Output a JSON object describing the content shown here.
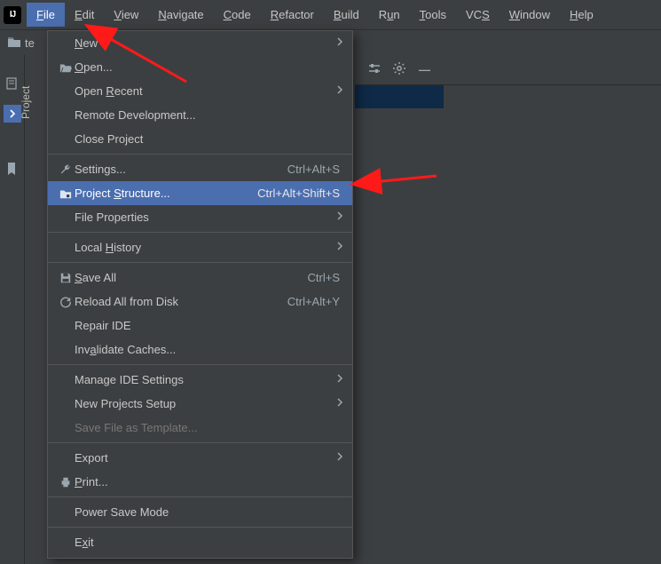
{
  "menubar": {
    "items": [
      {
        "label": "File",
        "mn": "F",
        "active": true
      },
      {
        "label": "Edit",
        "mn": "E",
        "active": false
      },
      {
        "label": "View",
        "mn": "V",
        "active": false
      },
      {
        "label": "Navigate",
        "mn": "N",
        "active": false
      },
      {
        "label": "Code",
        "mn": "C",
        "active": false
      },
      {
        "label": "Refactor",
        "mn": "R",
        "active": false
      },
      {
        "label": "Build",
        "mn": "B",
        "active": false
      },
      {
        "label": "Run",
        "mn": "u",
        "active": false
      },
      {
        "label": "Tools",
        "mn": "T",
        "active": false
      },
      {
        "label": "VCS",
        "mn": "S",
        "active": false
      },
      {
        "label": "Window",
        "mn": "W",
        "active": false
      },
      {
        "label": "Help",
        "mn": "H",
        "active": false
      }
    ]
  },
  "crumb": {
    "label": "te"
  },
  "side": {
    "label": "Project"
  },
  "dropdown": [
    {
      "type": "item",
      "label": "New",
      "mn": "N",
      "icon": "",
      "submenu": true
    },
    {
      "type": "item",
      "label": "Open...",
      "mn": "O",
      "icon": "folder-open"
    },
    {
      "type": "item",
      "label": "Open Recent",
      "mn": "R",
      "submenu": true
    },
    {
      "type": "item",
      "label": "Remote Development..."
    },
    {
      "type": "item",
      "label": "Close Project",
      "mn": "J"
    },
    {
      "type": "sep"
    },
    {
      "type": "item",
      "label": "Settings...",
      "mn": "T",
      "icon": "wrench",
      "shortcut": "Ctrl+Alt+S"
    },
    {
      "type": "item",
      "label": "Project Structure...",
      "mn": "S",
      "icon": "folder-gear",
      "shortcut": "Ctrl+Alt+Shift+S",
      "highlight": true
    },
    {
      "type": "item",
      "label": "File Properties",
      "submenu": true
    },
    {
      "type": "sep"
    },
    {
      "type": "item",
      "label": "Local History",
      "mn": "H",
      "submenu": true
    },
    {
      "type": "sep"
    },
    {
      "type": "item",
      "label": "Save All",
      "mn": "S",
      "icon": "save",
      "shortcut": "Ctrl+S"
    },
    {
      "type": "item",
      "label": "Reload All from Disk",
      "icon": "reload",
      "shortcut": "Ctrl+Alt+Y"
    },
    {
      "type": "item",
      "label": "Repair IDE"
    },
    {
      "type": "item",
      "label": "Invalidate Caches...",
      "mn": "a"
    },
    {
      "type": "sep"
    },
    {
      "type": "item",
      "label": "Manage IDE Settings",
      "submenu": true
    },
    {
      "type": "item",
      "label": "New Projects Setup",
      "submenu": true
    },
    {
      "type": "item",
      "label": "Save File as Template...",
      "disabled": true
    },
    {
      "type": "sep"
    },
    {
      "type": "item",
      "label": "Export",
      "submenu": true
    },
    {
      "type": "item",
      "label": "Print...",
      "mn": "P",
      "icon": "print"
    },
    {
      "type": "sep"
    },
    {
      "type": "item",
      "label": "Power Save Mode"
    },
    {
      "type": "sep"
    },
    {
      "type": "item",
      "label": "Exit",
      "mn": "x"
    }
  ]
}
